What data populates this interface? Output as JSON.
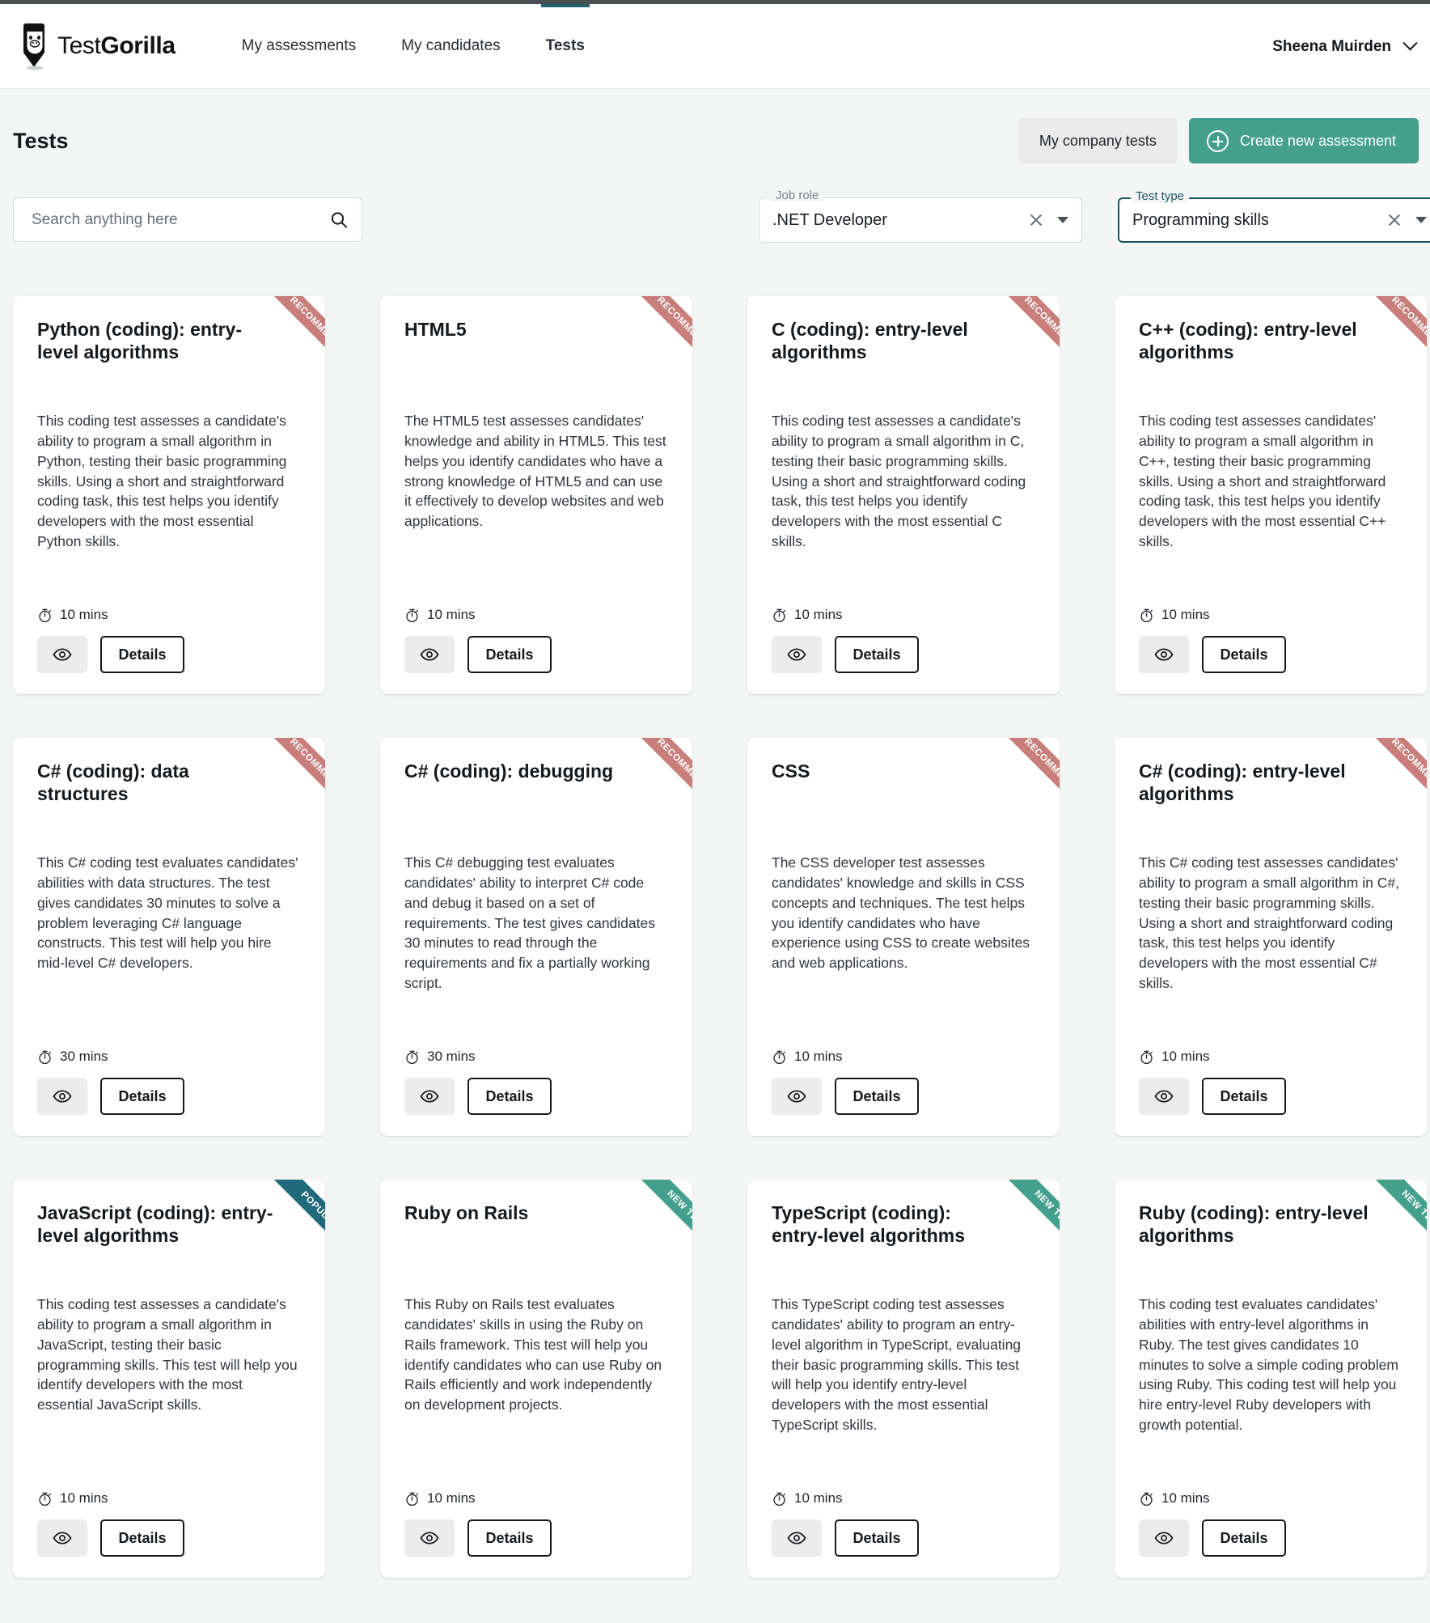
{
  "brand": {
    "name_light": "Test",
    "name_bold": "Gorilla",
    "logo_icon": "gorilla-pencil-logo"
  },
  "nav": {
    "items": [
      {
        "label": "My assessments",
        "active": false
      },
      {
        "label": "My candidates",
        "active": false
      },
      {
        "label": "Tests",
        "active": true
      }
    ]
  },
  "user": {
    "name": "Sheena Muirden",
    "caret_icon": "chevron-down-icon"
  },
  "header": {
    "title": "Tests",
    "company_tests_label": "My company tests",
    "create_assessment_label": "Create new assessment",
    "create_icon": "plus-circle-icon",
    "accent_color": "#44a08d"
  },
  "search": {
    "placeholder": "Search anything here",
    "value": "",
    "icon": "search-icon"
  },
  "filters": [
    {
      "id": "job-role",
      "label": "Job role",
      "value": ".NET Developer",
      "focused": false,
      "clear_icon": "close-icon",
      "caret_icon": "chevron-down-icon"
    },
    {
      "id": "test-type",
      "label": "Test type",
      "value": "Programming skills",
      "focused": true,
      "clear_icon": "close-icon",
      "caret_icon": "chevron-down-icon"
    }
  ],
  "card_labels": {
    "details": "Details",
    "preview_icon": "eye-icon",
    "timer_icon": "stopwatch-icon"
  },
  "ribbon_colors": {
    "recommended": "#c87f7c",
    "popular": "#20697a",
    "new": "#44a08d"
  },
  "tests": [
    {
      "title": "Python (coding): entry-level algorithms",
      "description": "This coding test assesses a candidate's ability to program a small algorithm in Python, testing their basic programming skills. Using a short and straightforward coding task, this test helps you identify developers with the most essential Python skills.",
      "duration": "10 mins",
      "ribbon": "RECOMMENDED",
      "ribbon_type": "recommended"
    },
    {
      "title": "HTML5",
      "description": "The HTML5 test assesses candidates' knowledge and ability in HTML5. This test helps you identify candidates who have a strong knowledge of HTML5 and can use it effectively to develop websites and web applications.",
      "duration": "10 mins",
      "ribbon": "RECOMMENDED",
      "ribbon_type": "recommended"
    },
    {
      "title": "C (coding): entry-level algorithms",
      "description": "This coding test assesses a candidate's ability to program a small algorithm in C, testing their basic programming skills. Using a short and straightforward coding task, this test helps you identify developers with the most essential C skills.",
      "duration": "10 mins",
      "ribbon": "RECOMMENDED",
      "ribbon_type": "recommended"
    },
    {
      "title": "C++ (coding): entry-level algorithms",
      "description": "This coding test assesses candidates' ability to program a small algorithm in C++, testing their basic programming skills. Using a short and straightforward coding task, this test helps you identify developers with the most essential C++ skills.",
      "duration": "10 mins",
      "ribbon": "RECOMMENDED",
      "ribbon_type": "recommended"
    },
    {
      "title": "C# (coding): data structures",
      "description": "This C# coding test evaluates candidates' abilities with data structures. The test gives candidates 30 minutes to solve a problem leveraging C# language constructs. This test will help you hire mid-level C# developers.",
      "duration": "30 mins",
      "ribbon": "RECOMMENDED",
      "ribbon_type": "recommended"
    },
    {
      "title": "C# (coding): debugging",
      "description": "This C# debugging test evaluates candidates' ability to interpret C# code and debug it based on a set of requirements. The test gives candidates 30 minutes to read through the requirements and fix a partially working script.",
      "duration": "30 mins",
      "ribbon": "RECOMMENDED",
      "ribbon_type": "recommended"
    },
    {
      "title": "CSS",
      "description": "The CSS developer test assesses candidates' knowledge and skills in CSS concepts and techniques. The test helps you identify candidates who have experience using CSS to create websites and web applications.",
      "duration": "10 mins",
      "ribbon": "RECOMMENDED",
      "ribbon_type": "recommended"
    },
    {
      "title": "C# (coding): entry-level algorithms",
      "description": "This C# coding test assesses candidates' ability to program a small algorithm in C#, testing their basic programming skills. Using a short and straightforward coding task, this test helps you identify developers with the most essential C# skills.",
      "duration": "10 mins",
      "ribbon": "RECOMMENDED",
      "ribbon_type": "recommended"
    },
    {
      "title": "JavaScript (coding): entry-level algorithms",
      "description": "This coding test assesses a candidate's ability to program a small algorithm in JavaScript, testing their basic programming skills. This test will help you identify developers with the most essential JavaScript skills.",
      "duration": "10 mins",
      "ribbon": "POPULAR",
      "ribbon_type": "popular"
    },
    {
      "title": "Ruby on Rails",
      "description": "This Ruby on Rails test evaluates candidates' skills in using the Ruby on Rails framework. This test will help you identify candidates who can use Ruby on Rails efficiently and work independently on development projects.",
      "duration": "10 mins",
      "ribbon": "NEW TEST",
      "ribbon_type": "new"
    },
    {
      "title": "TypeScript (coding): entry-level algorithms",
      "description": "This TypeScript coding test assesses candidates' ability to program an entry-level algorithm in TypeScript, evaluating their basic programming skills. This test will help you identify entry-level developers with the most essential TypeScript skills.",
      "duration": "10 mins",
      "ribbon": "NEW TEST",
      "ribbon_type": "new"
    },
    {
      "title": "Ruby (coding): entry-level algorithms",
      "description": "This coding test evaluates candidates' abilities with entry-level algorithms in Ruby. The test gives candidates 10 minutes to solve a simple coding problem using Ruby. This coding test will help you hire entry-level Ruby developers with growth potential.",
      "duration": "10 mins",
      "ribbon": "NEW TEST",
      "ribbon_type": "new"
    }
  ]
}
